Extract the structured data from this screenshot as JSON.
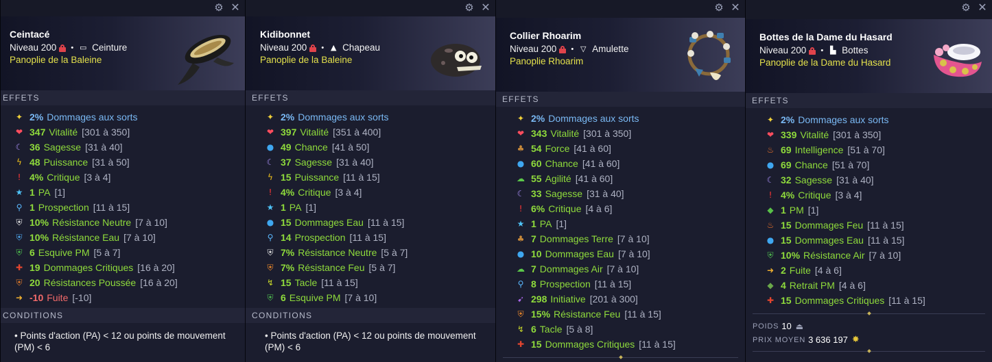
{
  "section_labels": {
    "effects": "EFFETS",
    "conditions": "CONDITIONS",
    "weight": "POIDS",
    "avg_price": "PRIX MOYEN"
  },
  "colors": {
    "green": "#8fdb3c",
    "blue": "#7ab9f4",
    "red": "#f36a6a",
    "set": "#e3e04c",
    "range": "#aeb2c3"
  },
  "cards": [
    {
      "title": "Ceintacé",
      "level": "Niveau 200",
      "type_icon": "belt-icon",
      "type": "Ceinture",
      "set": "Panoplie de la Baleine",
      "effects": [
        {
          "icon": "star-icon",
          "value": "2%",
          "label": "Dommages aux sorts",
          "range": "",
          "color": "blue"
        },
        {
          "icon": "heart-icon",
          "value": "347",
          "label": "Vitalité",
          "range": "[301 à 350]",
          "color": "green"
        },
        {
          "icon": "moon-icon",
          "value": "36",
          "label": "Sagesse",
          "range": "[31 à 40]",
          "color": "green"
        },
        {
          "icon": "lightning-icon",
          "value": "48",
          "label": "Puissance",
          "range": "[31 à 50]",
          "color": "green"
        },
        {
          "icon": "exclamation-icon",
          "value": "4%",
          "label": "Critique",
          "range": "[3 à 4]",
          "color": "green"
        },
        {
          "icon": "star-blue-icon",
          "value": "1",
          "label": "PA",
          "range": "[1]",
          "color": "green"
        },
        {
          "icon": "magnifier-icon",
          "value": "1",
          "label": "Prospection",
          "range": "[11 à 15]",
          "color": "green"
        },
        {
          "icon": "shield-neutral-icon",
          "value": "10%",
          "label": "Résistance Neutre",
          "range": "[7 à 10]",
          "color": "green"
        },
        {
          "icon": "shield-water-icon",
          "value": "10%",
          "label": "Résistance Eau",
          "range": "[7 à 10]",
          "color": "green"
        },
        {
          "icon": "shield-green-icon",
          "value": "6",
          "label": "Esquive PM",
          "range": "[5 à 7]",
          "color": "green"
        },
        {
          "icon": "crit-damage-icon",
          "value": "19",
          "label": "Dommages Critiques",
          "range": "[16 à 20]",
          "color": "green"
        },
        {
          "icon": "shield-push-icon",
          "value": "20",
          "label": "Résistances Poussée",
          "range": "[16 à 20]",
          "color": "green"
        },
        {
          "icon": "flee-icon",
          "value": "-10",
          "label": "Fuite",
          "range": "[-10]",
          "color": "red"
        }
      ],
      "conditions": [
        "• Points d'action (PA) < 12 ou points de mouvement (PM) < 6"
      ]
    },
    {
      "title": "Kidibonnet",
      "level": "Niveau 200",
      "type_icon": "hat-icon",
      "type": "Chapeau",
      "set": "Panoplie de la Baleine",
      "effects": [
        {
          "icon": "star-icon",
          "value": "2%",
          "label": "Dommages aux sorts",
          "range": "",
          "color": "blue"
        },
        {
          "icon": "heart-icon",
          "value": "397",
          "label": "Vitalité",
          "range": "[351 à 400]",
          "color": "green"
        },
        {
          "icon": "water-drop-icon",
          "value": "49",
          "label": "Chance",
          "range": "[41 à 50]",
          "color": "green"
        },
        {
          "icon": "moon-icon",
          "value": "37",
          "label": "Sagesse",
          "range": "[31 à 40]",
          "color": "green"
        },
        {
          "icon": "lightning-icon",
          "value": "15",
          "label": "Puissance",
          "range": "[11 à 15]",
          "color": "green"
        },
        {
          "icon": "exclamation-icon",
          "value": "4%",
          "label": "Critique",
          "range": "[3 à 4]",
          "color": "green"
        },
        {
          "icon": "star-blue-icon",
          "value": "1",
          "label": "PA",
          "range": "[1]",
          "color": "green"
        },
        {
          "icon": "water-drop-icon",
          "value": "15",
          "label": "Dommages Eau",
          "range": "[11 à 15]",
          "color": "green"
        },
        {
          "icon": "magnifier-icon",
          "value": "14",
          "label": "Prospection",
          "range": "[11 à 15]",
          "color": "green"
        },
        {
          "icon": "shield-neutral-icon",
          "value": "7%",
          "label": "Résistance Neutre",
          "range": "[5 à 7]",
          "color": "green"
        },
        {
          "icon": "shield-fire-icon",
          "value": "7%",
          "label": "Résistance Feu",
          "range": "[5 à 7]",
          "color": "green"
        },
        {
          "icon": "tackle-icon",
          "value": "15",
          "label": "Tacle",
          "range": "[11 à 15]",
          "color": "green"
        },
        {
          "icon": "shield-green-icon",
          "value": "6",
          "label": "Esquive PM",
          "range": "[7 à 10]",
          "color": "green"
        }
      ],
      "conditions": [
        "• Points d'action (PA) < 12 ou points de mouvement (PM) < 6"
      ]
    },
    {
      "title": "Collier Rhoarim",
      "level": "Niveau 200",
      "type_icon": "amulet-icon",
      "type": "Amulette",
      "set": "Panoplie Rhoarim",
      "effects": [
        {
          "icon": "star-icon",
          "value": "2%",
          "label": "Dommages aux sorts",
          "range": "",
          "color": "blue"
        },
        {
          "icon": "heart-icon",
          "value": "343",
          "label": "Vitalité",
          "range": "[301 à 350]",
          "color": "green"
        },
        {
          "icon": "earth-icon",
          "value": "54",
          "label": "Force",
          "range": "[41 à 60]",
          "color": "green"
        },
        {
          "icon": "water-drop-icon",
          "value": "60",
          "label": "Chance",
          "range": "[41 à 60]",
          "color": "green"
        },
        {
          "icon": "air-icon",
          "value": "55",
          "label": "Agilité",
          "range": "[41 à 60]",
          "color": "green"
        },
        {
          "icon": "moon-icon",
          "value": "33",
          "label": "Sagesse",
          "range": "[31 à 40]",
          "color": "green"
        },
        {
          "icon": "exclamation-icon",
          "value": "6%",
          "label": "Critique",
          "range": "[4 à 6]",
          "color": "green"
        },
        {
          "icon": "star-blue-icon",
          "value": "1",
          "label": "PA",
          "range": "[1]",
          "color": "green"
        },
        {
          "icon": "earth-icon",
          "value": "7",
          "label": "Dommages Terre",
          "range": "[7 à 10]",
          "color": "green"
        },
        {
          "icon": "water-drop-icon",
          "value": "10",
          "label": "Dommages Eau",
          "range": "[7 à 10]",
          "color": "green"
        },
        {
          "icon": "air-icon",
          "value": "7",
          "label": "Dommages Air",
          "range": "[7 à 10]",
          "color": "green"
        },
        {
          "icon": "magnifier-icon",
          "value": "8",
          "label": "Prospection",
          "range": "[11 à 15]",
          "color": "green"
        },
        {
          "icon": "initiative-icon",
          "value": "298",
          "label": "Initiative",
          "range": "[201 à 300]",
          "color": "green"
        },
        {
          "icon": "shield-fire-icon",
          "value": "15%",
          "label": "Résistance Feu",
          "range": "[11 à 15]",
          "color": "green"
        },
        {
          "icon": "tackle-icon",
          "value": "6",
          "label": "Tacle",
          "range": "[5 à 8]",
          "color": "green"
        },
        {
          "icon": "crit-damage-icon",
          "value": "15",
          "label": "Dommages Critiques",
          "range": "[11 à 15]",
          "color": "green"
        }
      ],
      "conditions": []
    },
    {
      "title": "Bottes de la Dame du Hasard",
      "level": "Niveau 200",
      "type_icon": "boot-icon",
      "type": "Bottes",
      "set": "Panoplie de la Dame du Hasard",
      "effects": [
        {
          "icon": "star-icon",
          "value": "2%",
          "label": "Dommages aux sorts",
          "range": "",
          "color": "blue"
        },
        {
          "icon": "heart-icon",
          "value": "339",
          "label": "Vitalité",
          "range": "[301 à 350]",
          "color": "green"
        },
        {
          "icon": "fire-icon",
          "value": "69",
          "label": "Intelligence",
          "range": "[51 à 70]",
          "color": "green"
        },
        {
          "icon": "water-drop-icon",
          "value": "69",
          "label": "Chance",
          "range": "[51 à 70]",
          "color": "green"
        },
        {
          "icon": "moon-icon",
          "value": "32",
          "label": "Sagesse",
          "range": "[31 à 40]",
          "color": "green"
        },
        {
          "icon": "exclamation-icon",
          "value": "4%",
          "label": "Critique",
          "range": "[3 à 4]",
          "color": "green"
        },
        {
          "icon": "diamond-pm-icon",
          "value": "1",
          "label": "PM",
          "range": "[1]",
          "color": "green"
        },
        {
          "icon": "fire-icon",
          "value": "15",
          "label": "Dommages Feu",
          "range": "[11 à 15]",
          "color": "green"
        },
        {
          "icon": "water-drop-icon",
          "value": "15",
          "label": "Dommages Eau",
          "range": "[11 à 15]",
          "color": "green"
        },
        {
          "icon": "shield-green-icon",
          "value": "10%",
          "label": "Résistance Air",
          "range": "[7 à 10]",
          "color": "green"
        },
        {
          "icon": "flee-icon",
          "value": "2",
          "label": "Fuite",
          "range": "[4 à 6]",
          "color": "green"
        },
        {
          "icon": "mp-reduction-icon",
          "value": "4",
          "label": "Retrait PM",
          "range": "[4 à 6]",
          "color": "green"
        },
        {
          "icon": "crit-damage-icon",
          "value": "15",
          "label": "Dommages Critiques",
          "range": "[11 à 15]",
          "color": "green"
        }
      ],
      "weight": "10",
      "avg_price": "3 636 197"
    }
  ]
}
